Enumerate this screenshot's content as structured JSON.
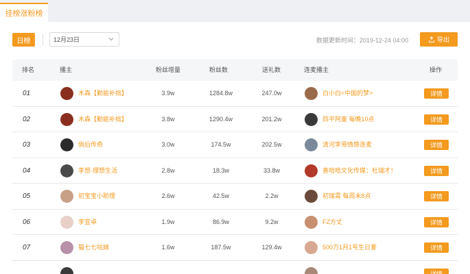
{
  "tab": {
    "label": "挂榜涨粉榜"
  },
  "toolbar": {
    "day_button": "日榜",
    "date_value": "12月23日",
    "updated_text": "数据更新时间：2019-12-24 04:00",
    "export_label": "导出"
  },
  "table": {
    "headers": [
      "排名",
      "播主",
      "粉丝增量",
      "粉丝数",
      "送礼数",
      "连麦播主",
      "操作"
    ],
    "rows": [
      {
        "rank": "01",
        "host": "木森【勤能补拙】",
        "fan_gain": "3.9w",
        "fans": "1284.8w",
        "gifts": "247.0w",
        "mic_host": "白小白<中国的梦>",
        "action": "详情",
        "av1": "#8a2e1f",
        "av2": "#9a6b4a"
      },
      {
        "rank": "02",
        "host": "木森【勤能补拙】",
        "fan_gain": "3.8w",
        "fans": "1290.4w",
        "gifts": "201.2w",
        "mic_host": "四平阿董 每晚10点",
        "action": "详情",
        "av1": "#8a2e1f",
        "av2": "#3a3a3a"
      },
      {
        "rank": "03",
        "host": "倘后传奇",
        "fan_gain": "3.0w",
        "fans": "174.5w",
        "gifts": "202.5w",
        "mic_host": "清河李哥情感连麦",
        "action": "详情",
        "av1": "#2a2a2a",
        "av2": "#7a8a9a"
      },
      {
        "rank": "04",
        "host": "李想-理想生活",
        "fan_gain": "2.8w",
        "fans": "18.3w",
        "gifts": "33.8w",
        "mic_host": "喜哈哈文化传媒：杜瑞才！",
        "action": "详情",
        "av1": "#4a4a4a",
        "av2": "#b23a2a"
      },
      {
        "rank": "05",
        "host": "初宝宝小助理",
        "fan_gain": "2.6w",
        "fans": "42.5w",
        "gifts": "2.2w",
        "mic_host": "初瑞霄 每周末8点",
        "action": "详情",
        "av1": "#c8a088",
        "av2": "#6a4a3a"
      },
      {
        "rank": "06",
        "host": "李宣卓",
        "fan_gain": "1.9w",
        "fans": "86.9w",
        "gifts": "9.2w",
        "mic_host": "FZ方丈",
        "action": "详情",
        "av1": "#e8d0c8",
        "av2": "#c89070"
      },
      {
        "rank": "07",
        "host": "猫七七咕娘",
        "fan_gain": "1.6w",
        "fans": "187.5w",
        "gifts": "129.4w",
        "mic_host": "500万1月1号生日宴",
        "action": "详情",
        "av1": "#b890a8",
        "av2": "#d8a890"
      }
    ]
  }
}
